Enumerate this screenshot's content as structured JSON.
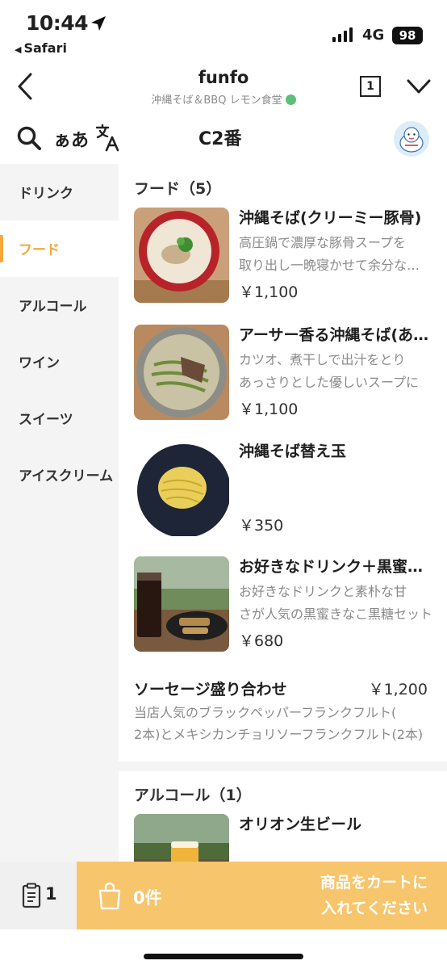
{
  "status_bar": {
    "time": "10:44",
    "back_app": "Safari",
    "network": "4G",
    "battery": "98"
  },
  "header": {
    "title": "funfo",
    "subtitle": "沖縄そば＆BBQ レモン食堂",
    "tab_count": "1"
  },
  "toolbar": {
    "font_size_label": "ぁあ",
    "table": "C2番"
  },
  "sidebar": {
    "items": [
      {
        "label": "ドリンク"
      },
      {
        "label": "フード"
      },
      {
        "label": "アルコール"
      },
      {
        "label": "ワイン"
      },
      {
        "label": "スイーツ"
      },
      {
        "label": "アイスクリーム"
      }
    ],
    "active_index": 1
  },
  "sections": [
    {
      "title": "フード（5）",
      "items": [
        {
          "name": "沖縄そば(クリーミー豚骨)",
          "desc": [
            "高圧鍋で濃厚な豚骨スープを",
            "取り出し一晩寝かせて余分な脂を取り除いた"
          ],
          "price": "￥1,100"
        },
        {
          "name": "アーサー香る沖縄そば(あっさり)",
          "desc": [
            "カツオ、煮干しで出汁をとり",
            "あっさりとした優しいスープに"
          ],
          "price": "￥1,100"
        },
        {
          "name": "沖縄そば替え玉",
          "desc": [],
          "price": "￥350"
        },
        {
          "name": "お好きなドリンク＋黒蜜きなこ黒糖",
          "desc": [
            "お好きなドリンクと素朴な甘",
            "さが人気の黒蜜きなこ黒糖セット"
          ],
          "price": "￥680"
        },
        {
          "name": "ソーセージ盛り合わせ",
          "desc": [
            "当店人気のブラックペッパーフランクフルト(",
            "2本)とメキシカンチョリソーフランクフルト(2本)"
          ],
          "price": "￥1,200"
        }
      ]
    },
    {
      "title": "アルコール（1）",
      "items": [
        {
          "name": "オリオン生ビール",
          "desc": [],
          "price": ""
        }
      ]
    }
  ],
  "bottom_bar": {
    "orders_count": "1",
    "cart_count": "0件",
    "cart_message_line1": "商品をカートに",
    "cart_message_line2": "入れてください"
  },
  "colors": {
    "accent": "#f4a93b",
    "cart_bar": "#f6c56c",
    "sidebar_bg": "#f4f4f4",
    "muted_text": "#8a8a8a"
  },
  "icons": [
    "location-arrow-icon",
    "signal-icon",
    "back-chevron-icon",
    "tab-count-icon",
    "chevron-down-icon",
    "search-icon",
    "translate-icon",
    "avatar",
    "clipboard-icon",
    "shopping-bag-icon"
  ]
}
